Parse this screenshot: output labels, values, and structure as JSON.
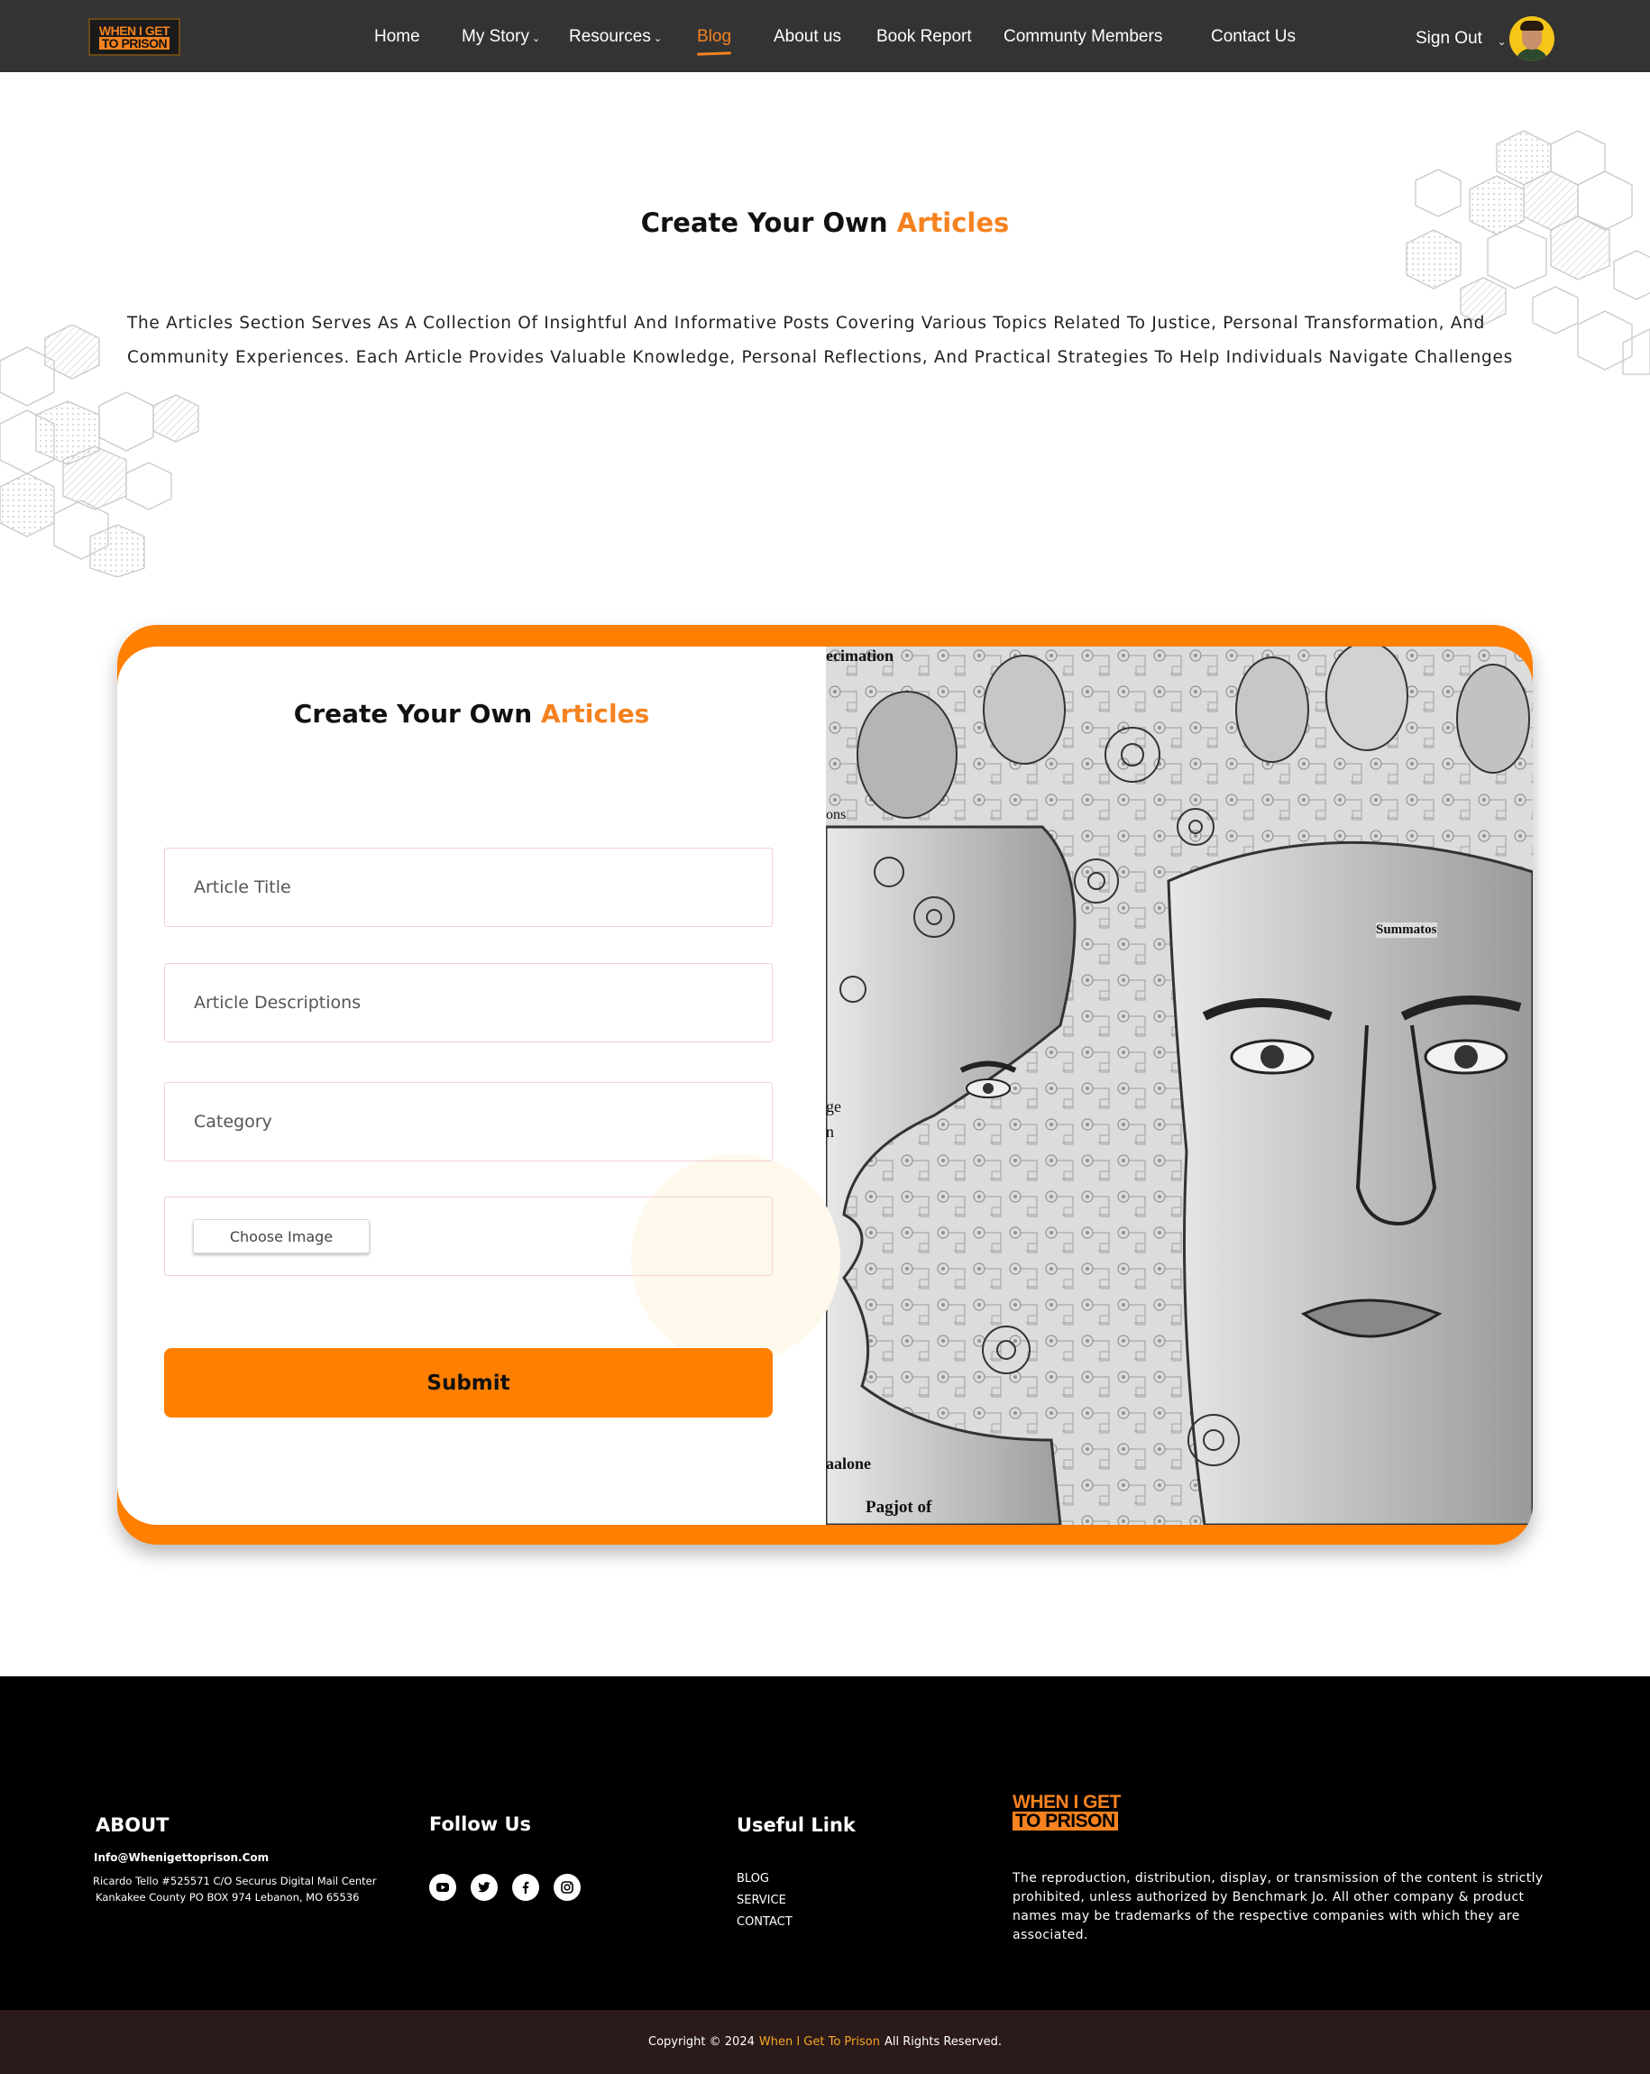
{
  "logo": {
    "line1": "WHEN I GET",
    "line2": "TO PRISON"
  },
  "nav": {
    "items": [
      {
        "label": "Home"
      },
      {
        "label": "My Story",
        "dropdown": true
      },
      {
        "label": "Resources",
        "dropdown": true
      },
      {
        "label": "Blog",
        "active": true
      },
      {
        "label": "About us"
      },
      {
        "label": "Book Report"
      },
      {
        "label": "Communty Members"
      },
      {
        "label": "Contact Us"
      }
    ],
    "signout": "Sign Out",
    "chevron": "⌄"
  },
  "hero": {
    "title_prefix": "Create Your Own",
    "title_accent": "Articles",
    "description": "The Articles Section Serves As A Collection Of Insightful And Informative Posts Covering Various Topics Related To Justice, Personal Transformation, And Community Experiences. Each Article Provides Valuable Knowledge, Personal Reflections, And Practical Strategies To Help Individuals Navigate Challenges"
  },
  "form": {
    "title_prefix": "Create Your Own",
    "title_accent": "Articles",
    "fields": {
      "title_placeholder": "Article Title",
      "description_placeholder": "Article Descriptions",
      "category_placeholder": "Category",
      "image_button": "Choose Image"
    },
    "submit": "Submit"
  },
  "image": {
    "overlay_texts": [
      "ecimation",
      "ons",
      "ge",
      "n",
      "Summatos",
      "aalone",
      "Pagjot of"
    ]
  },
  "footer": {
    "about": {
      "heading": "ABOUT",
      "email": "Info@Whenigettoprison.Com",
      "address_line1": "Ricardo Tello #525571 C/O Securus Digital Mail Center",
      "address_line2": "Kankakee County PO BOX 974 Lebanon, MO 65536"
    },
    "follow": {
      "heading": "Follow Us",
      "icons": [
        "youtube-icon",
        "twitter-icon",
        "facebook-icon",
        "instagram-icon"
      ]
    },
    "links": {
      "heading": "Useful Link",
      "items": [
        "BLOG",
        "SERVICE",
        "CONTACT"
      ]
    },
    "logo": {
      "line1": "WHEN I GET",
      "line2": "TO PRISON"
    },
    "legal": "The reproduction, distribution, display, or transmission of the content is strictly prohibited, unless authorized by Benchmark Jo. All other company & product names may be trademarks of the respective companies with which they are associated."
  },
  "copyright": {
    "prefix": "Copyright © 2024",
    "brand": "When I Get To Prison",
    "suffix": "All Rights Reserved."
  },
  "colors": {
    "accent": "#f5821f",
    "button": "#ff7f00",
    "nav_bg": "#333333",
    "footer_bg": "#000000",
    "copyright_bg": "#2b1a1a"
  }
}
